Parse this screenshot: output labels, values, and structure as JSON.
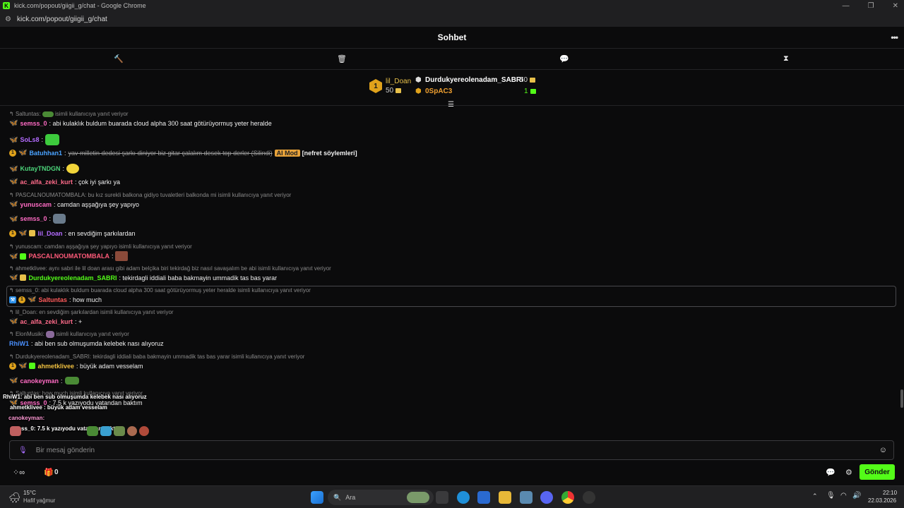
{
  "window": {
    "title": "kick.com/popout/giigii_g/chat - Google Chrome",
    "url": "kick.com/popout/giigii_g/chat",
    "fav": "K"
  },
  "header": {
    "title": "Sohbet"
  },
  "tools": [
    "hammer-icon",
    "trash-icon",
    "chat-bubble-icon",
    "hourglass-icon"
  ],
  "leaderboard": {
    "rank": "1",
    "first": {
      "name": "lil_Doan",
      "amount": "50"
    },
    "second": {
      "name": "Durdukyereolenadam_SABRI",
      "amount": "50"
    },
    "third": {
      "name": "0SpAC3",
      "amount": "1"
    }
  },
  "colors": {
    "accent": "#53fc18",
    "gold": "#e0a21b",
    "pink": "#ff6bc4"
  },
  "chat": {
    "r1": {
      "who": "Saltuntas:",
      "text": "isimli kullanıcıya yanıt veriyor"
    },
    "m1": {
      "name": "semss_0",
      "text": ": abi kulaklık buldum buarada cloud alpha 300 saat götürüyormuş yeter heralde"
    },
    "m2": {
      "name": "SoLs8",
      "text": ":"
    },
    "m3": {
      "name": "Batuhhan1",
      "text": "yav milletin dedesi şarkı diniyor biz gitar çalalım desek top derler (Silindi)",
      "mod": "AI Mod",
      "tag": "[nefret söylemleri]"
    },
    "m4": {
      "name": "KutayTNDGN",
      "text": ":"
    },
    "m5": {
      "name": "ac_alfa_zeki_kurt",
      "text": ": çok iyi şarkı ya"
    },
    "r2": {
      "text": "PASCALNOUMATOMBALA: bu kız surekli balkona gidiyo tuvaletleri balkonda mi isimli kullanıcıya yanıt veriyor"
    },
    "m6": {
      "name": "yunuscam",
      "text": ": camdan aşşağıya şey yapıyo"
    },
    "m7": {
      "name": "semss_0",
      "text": ":"
    },
    "m8": {
      "name": "lil_Doan",
      "text": ": en sevdiğim şarkılardan"
    },
    "r3": {
      "text": "yunuscam: camdan aşşağıya şey yapıyo isimli kullanıcıya yanıt veriyor"
    },
    "m9": {
      "name": "PASCALNOUMATOMBALA",
      "text": ":"
    },
    "r4": {
      "text": "ahmetklivee: aynı sabri ile lil doan arası gibi adam belçika biri tekirdağ biz nasıl savaşalım be abi isimli kullanıcıya yanıt veriyor"
    },
    "m10": {
      "name": "Durdukyereolenadam_SABRI",
      "text": ": tekirdagli iddiali baba bakmayin ummadik tas bas yarar"
    },
    "r5": {
      "text": "semss_0: abi kulaklık buldum buarada cloud alpha 300 saat götürüyormuş yeter heralde isimli kullanıcıya yanıt veriyor"
    },
    "m11": {
      "name": "Saltuntas",
      "text": ": how much"
    },
    "r6": {
      "text": "lil_Doan: en sevdiğim şarkılardan isimli kullanıcıya yanıt veriyor"
    },
    "m12": {
      "name": "ac_alfa_zeki_kurt",
      "text": ": +"
    },
    "r7": {
      "who": "ElonMusiki:",
      "text": "isimli kullanıcıya yanıt veriyor"
    },
    "m13": {
      "name": "RhiW1",
      "text": ": abi ben sub olmuşumda kelebek nası alıyoruz"
    },
    "r8": {
      "text": "Durdukyereolenadam_SABRI: tekirdagli iddiali baba bakmayin ummadik tas bas yarar isimli kullanıcıya yanıt veriyor"
    },
    "m14": {
      "name": "ahmetklivee",
      "text": ": büyük adam vesselam"
    },
    "m15": {
      "name": "canokeyman",
      "text": ":"
    },
    "r9": {
      "text": "Saltuntas: how much isimli kullanıcıya yanıt veriyor"
    },
    "m16": {
      "name": "semss_0",
      "text": ": 7.5 k yazıyodu vatandan baktım"
    }
  },
  "overlay": {
    "o1": "RhiW1: abi ben sub olmuşumda kelebek nası alıyoruz",
    "o2": "ahmetklivee : büyük adam vesselam",
    "o3": "canokeyman:",
    "o4": "semss_0: 7.5 k yazıyodu vatandan baktım"
  },
  "input": {
    "placeholder": "Bir mesaj gönderin"
  },
  "bottom": {
    "count": "0",
    "send": "Gönder"
  },
  "taskbar": {
    "temp": "15°C",
    "weather": "Hafif yağmur",
    "search": "Ara",
    "time": "22:10",
    "date": "22.03.2026"
  }
}
